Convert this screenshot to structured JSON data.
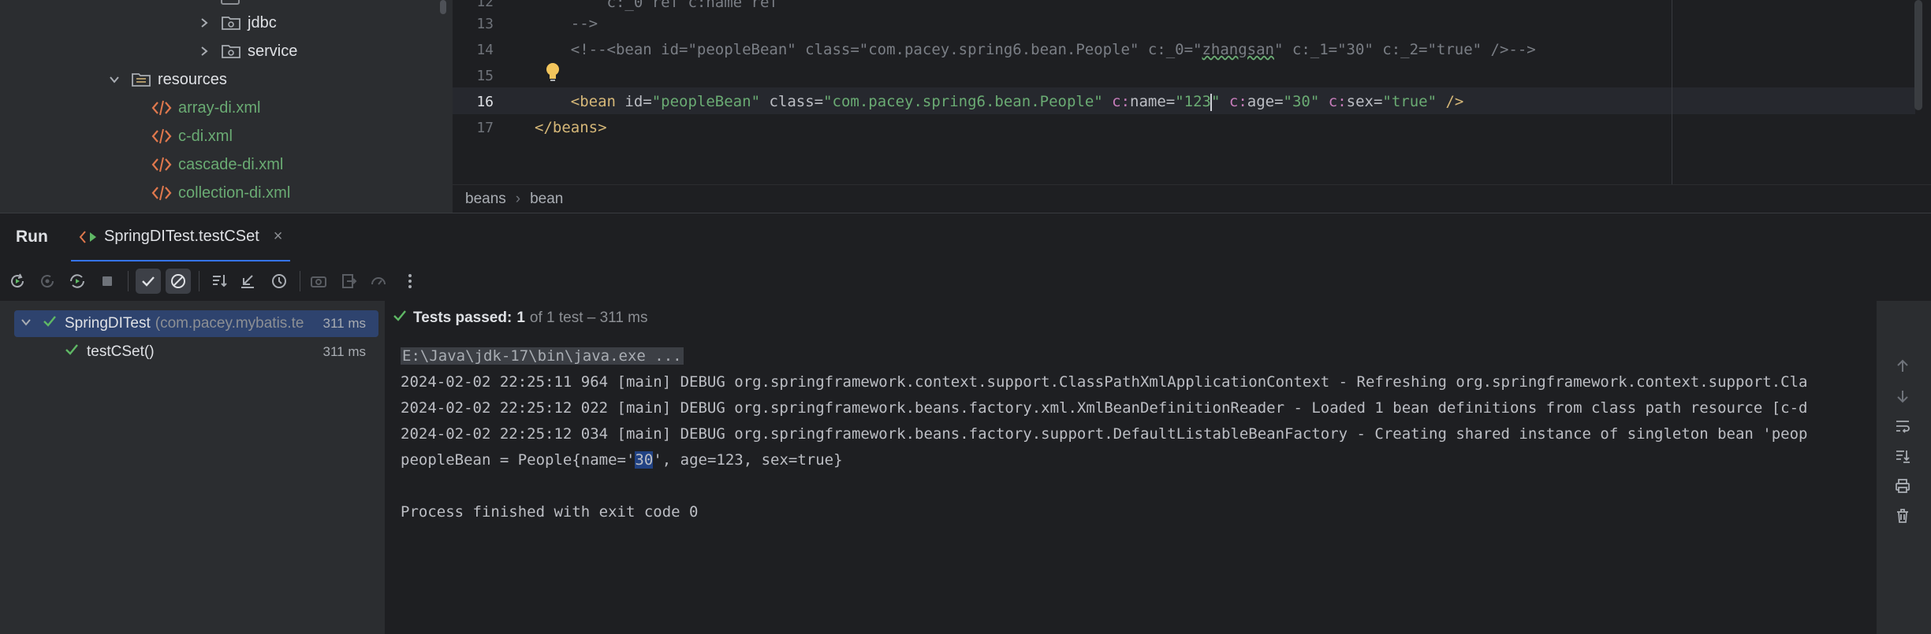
{
  "project_tree": {
    "items": [
      {
        "label": "jdbc",
        "type": "folder"
      },
      {
        "label": "service",
        "type": "folder"
      },
      {
        "label": "resources",
        "type": "resources-folder"
      },
      {
        "label": "array-di.xml",
        "type": "xml"
      },
      {
        "label": "c-di.xml",
        "type": "xml"
      },
      {
        "label": "cascade-di.xml",
        "type": "xml"
      },
      {
        "label": "collection-di.xml",
        "type": "xml"
      }
    ]
  },
  "editor": {
    "line_numbers": [
      "12",
      "13",
      "14",
      "15",
      "16",
      "17"
    ],
    "current_line": "16",
    "lines": {
      "l12": "        c:_0 ref c:name ref",
      "l13": "    -->",
      "l14": "    <!--<bean id=\"peopleBean\" class=\"com.pacey.spring6.bean.People\" c:_0=\"zhangsan\" c:_1=\"30\" c:_2=\"true\" />-->",
      "l16_parts": {
        "indent": "    ",
        "open": "<bean",
        "id_attr": " id=",
        "id_val": "\"peopleBean\"",
        "class_attr": " class=",
        "class_val": "\"com.pacey.spring6.bean.People\"",
        "c1": " c:",
        "name_attr": "name=",
        "name_val_pre": "\"123",
        "name_val_post": "\"",
        "c2": " c:",
        "age_attr": "age=",
        "age_val": "\"30\"",
        "c3": " c:",
        "sex_attr": "sex=",
        "sex_val": "\"true\"",
        "close": " />"
      },
      "l17": "</beans>"
    }
  },
  "breadcrumb": [
    "beans",
    "bean"
  ],
  "run_window": {
    "title": "Run",
    "tab_label": "SpringDITest.testCSet",
    "tab_close": "×"
  },
  "test_tree": {
    "root": {
      "name": "SpringDITest",
      "package": "(com.pacey.mybatis.te",
      "duration": "311 ms"
    },
    "child": {
      "name": "testCSet()",
      "duration": "311 ms"
    }
  },
  "status": {
    "label": "Tests passed:",
    "count": "1",
    "detail": "of 1 test – 311 ms"
  },
  "console": {
    "command": "E:\\Java\\jdk-17\\bin\\java.exe ...",
    "lines": [
      "2024-02-02 22:25:11 964 [main] DEBUG org.springframework.context.support.ClassPathXmlApplicationContext - Refreshing org.springframework.context.support.Cla",
      "2024-02-02 22:25:12 022 [main] DEBUG org.springframework.beans.factory.xml.XmlBeanDefinitionReader - Loaded 1 bean definitions from class path resource [c-d",
      "2024-02-02 22:25:12 034 [main] DEBUG org.springframework.beans.factory.support.DefaultListableBeanFactory - Creating shared instance of singleton bean 'peop"
    ],
    "result_pre": "peopleBean = People{name='",
    "result_hl": "30",
    "result_post": "', age=123, sex=true}",
    "exit": "Process finished with exit code 0"
  },
  "colors": {
    "accent": "#3574f0",
    "pass_green": "#5fb865",
    "xml_string": "#6aab73",
    "xml_tag": "#d5b778",
    "namespace": "#c77dbb"
  }
}
